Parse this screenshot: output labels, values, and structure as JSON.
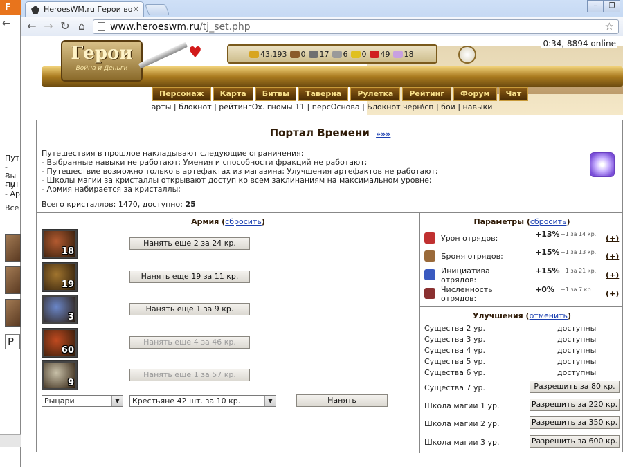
{
  "browser": {
    "tab_title": "HeroesWM.ru Герои во",
    "url_host": "www.heroeswm.ru",
    "url_path": "/tj_set.php",
    "back_window_letter": "F"
  },
  "back_window": {
    "lines": [
      "Пут",
      "- Вы",
      "- Пу",
      "- Ш",
      "- Ар"
    ],
    "bottom_text": "Все",
    "select_text": "Р"
  },
  "header": {
    "logo_title": "Герои",
    "logo_subtitle": "Война и Деньги",
    "online": "0:34, 8894 online",
    "resources": [
      {
        "name": "gold",
        "value": "43,193",
        "color": "#d8a520"
      },
      {
        "name": "wood",
        "value": "0",
        "color": "#8a5a2a"
      },
      {
        "name": "ore",
        "value": "17",
        "color": "#707070"
      },
      {
        "name": "mercury",
        "value": "6",
        "color": "#9a9a9a"
      },
      {
        "name": "sulfur",
        "value": "0",
        "color": "#e0c020"
      },
      {
        "name": "crystals",
        "value": "49",
        "color": "#d02020"
      },
      {
        "name": "gems",
        "value": "18",
        "color": "#c8a0e0"
      }
    ],
    "menu": [
      "Персонаж",
      "Карта",
      "Битвы",
      "Таверна",
      "Рулетка",
      "Рейтинг",
      "Форум",
      "Чат"
    ],
    "sublinks": "арты | блокнот | рейтингОх. гномы 11 | персОснова | Блокнот черн\\сп | бои | навыки"
  },
  "portal": {
    "title": "Портал Времени",
    "more_link": "»»»",
    "restrictions": [
      "Путешествия в прошлое накладывают следующие ограничения:",
      "- Выбранные навыки не работают; Умения и способности фракций не работают;",
      "- Путешествие возможно только в артефактах из магазина; Улучшения артефактов не работают;",
      "- Школы магии за кристаллы открывают доступ ко всем заклинаниям на максимальном уровне;",
      "- Армия набирается за кристаллы;"
    ],
    "crystals_label": "Всего кристаллов: 1470, доступно:",
    "crystals_available": "25"
  },
  "army": {
    "title": "Армия",
    "reset_link": "сбросить",
    "units": [
      {
        "count": "18",
        "button": "Нанять еще 2 за 24 кр.",
        "disabled": false,
        "color": "#b35a30"
      },
      {
        "count": "19",
        "button": "Нанять еще 19 за 11 кр.",
        "disabled": false,
        "color": "#a0742e"
      },
      {
        "count": "3",
        "button": "Нанять еще 1 за 9 кр.",
        "disabled": false,
        "color": "#6a86c8"
      },
      {
        "count": "60",
        "button": "Нанять еще 4 за 46 кр.",
        "disabled": true,
        "color": "#c04a20"
      },
      {
        "count": "9",
        "button": "Нанять еще 1 за 57 кр.",
        "disabled": true,
        "color": "#c8c0a8"
      }
    ],
    "faction_select": "Рыцари",
    "unit_select": "Крестьяне 42 шт. за 10 кр.",
    "hire_button": "Нанять"
  },
  "params": {
    "title": "Параметры",
    "reset_link": "сбросить",
    "rows": [
      {
        "label": "Урон отрядов:",
        "value": "+13%",
        "note": "+1 за 14 кр.",
        "plus": "(+)",
        "color": "#c03030"
      },
      {
        "label": "Броня отрядов:",
        "value": "+15%",
        "note": "+1 за 13 кр.",
        "plus": "(+)",
        "color": "#9a6a3a"
      },
      {
        "label": "Инициатива отрядов:",
        "value": "+15%",
        "note": "+1 за 21 кр.",
        "plus": "(+)",
        "color": "#3a5ac0"
      },
      {
        "label": "Численность отрядов:",
        "value": "+0%",
        "note": "+1 за 7 кр.",
        "plus": "(+)",
        "color": "#8a3030"
      }
    ]
  },
  "upgrades": {
    "title": "Улучшения",
    "cancel_link": "отменить",
    "available": [
      {
        "label": "Существа 2 ур.",
        "status": "доступны"
      },
      {
        "label": "Существа 3 ур.",
        "status": "доступны"
      },
      {
        "label": "Существа 4 ур.",
        "status": "доступны"
      },
      {
        "label": "Существа 5 ур.",
        "status": "доступны"
      },
      {
        "label": "Существа 6 ур.",
        "status": "доступны"
      }
    ],
    "locked": [
      {
        "label": "Существа 7 ур.",
        "button": "Разрешить за 80 кр."
      },
      {
        "label": "Школа магии 1 ур.",
        "button": "Разрешить за 220 кр."
      },
      {
        "label": "Школа магии 2 ур.",
        "button": "Разрешить за 350 кр."
      },
      {
        "label": "Школа магии 3 ур.",
        "button": "Разрешить за 600 кр."
      }
    ]
  }
}
